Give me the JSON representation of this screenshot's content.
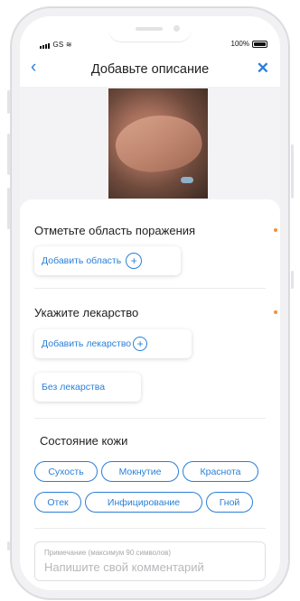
{
  "status_bar": {
    "carrier": "GS",
    "battery": "100%"
  },
  "nav": {
    "back_icon": "‹",
    "title": "Добавьте описание",
    "close_icon": "✕"
  },
  "sections": {
    "area": {
      "title": "Отметьте область поражения",
      "add_label": "Добавить область"
    },
    "medicine": {
      "title": "Укажите лекарство",
      "add_label": "Добавить лекарство",
      "none_label": "Без лекарства"
    },
    "skin": {
      "title": "Состояние кожи",
      "chips": [
        "Сухость",
        "Мокнутие",
        "Краснота",
        "Отек",
        "Инфицирование",
        "Гной"
      ]
    }
  },
  "comment": {
    "hint": "Примечание (максимум 90 символов)",
    "placeholder": "Напишите свой комментарий"
  },
  "colors": {
    "accent": "#2a7fd7",
    "required_dot": "#f0913a"
  }
}
